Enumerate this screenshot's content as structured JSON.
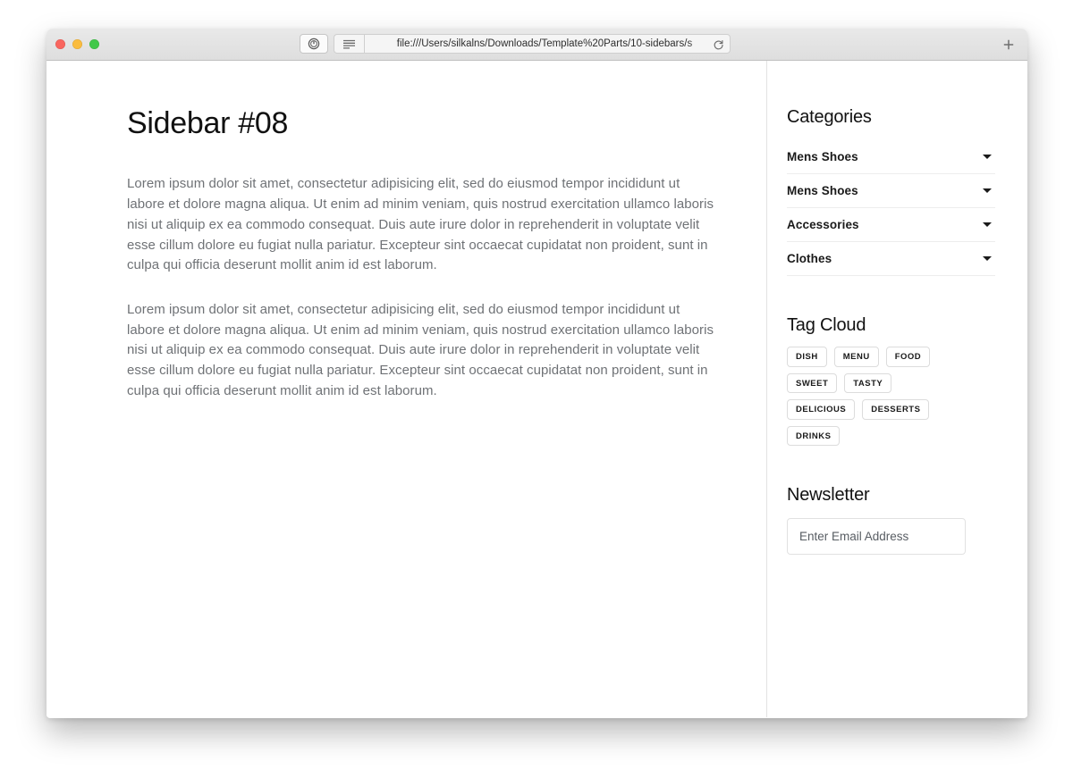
{
  "browser": {
    "window_controls": [
      {
        "name": "close",
        "color": "#f9665f"
      },
      {
        "name": "minimize",
        "color": "#fabc3f"
      },
      {
        "name": "zoom",
        "color": "#41c84a"
      }
    ],
    "url": "file:///Users/silkalns/Downloads/Template%20Parts/10-sidebars/s",
    "icons": {
      "privacy": "shield-power-icon",
      "reader": "reader-view-icon",
      "reload": "reload-icon",
      "newtab": "plus-icon"
    }
  },
  "main": {
    "title": "Sidebar #08",
    "paragraphs": [
      "Lorem ipsum dolor sit amet, consectetur adipisicing elit, sed do eiusmod tempor incididunt ut labore et dolore magna aliqua. Ut enim ad minim veniam, quis nostrud exercitation ullamco laboris nisi ut aliquip ex ea commodo consequat. Duis aute irure dolor in reprehenderit in voluptate velit esse cillum dolore eu fugiat nulla pariatur. Excepteur sint occaecat cupidatat non proident, sunt in culpa qui officia deserunt mollit anim id est laborum.",
      "Lorem ipsum dolor sit amet, consectetur adipisicing elit, sed do eiusmod tempor incididunt ut labore et dolore magna aliqua. Ut enim ad minim veniam, quis nostrud exercitation ullamco laboris nisi ut aliquip ex ea commodo consequat. Duis aute irure dolor in reprehenderit in voluptate velit esse cillum dolore eu fugiat nulla pariatur. Excepteur sint occaecat cupidatat non proident, sunt in culpa qui officia deserunt mollit anim id est laborum."
    ]
  },
  "sidebar": {
    "categories": {
      "title": "Categories",
      "items": [
        {
          "label": "Mens Shoes"
        },
        {
          "label": "Mens Shoes"
        },
        {
          "label": "Accessories"
        },
        {
          "label": "Clothes"
        }
      ]
    },
    "tag_cloud": {
      "title": "Tag Cloud",
      "tags": [
        "DISH",
        "MENU",
        "FOOD",
        "SWEET",
        "TASTY",
        "DELICIOUS",
        "DESSERTS",
        "DRINKS"
      ]
    },
    "newsletter": {
      "title": "Newsletter",
      "email_placeholder": "Enter Email Address",
      "email_value": ""
    }
  },
  "colors": {
    "text_primary": "#111111",
    "text_body": "#6f7276",
    "border": "#e3e3e3",
    "background": "#ffffff"
  }
}
